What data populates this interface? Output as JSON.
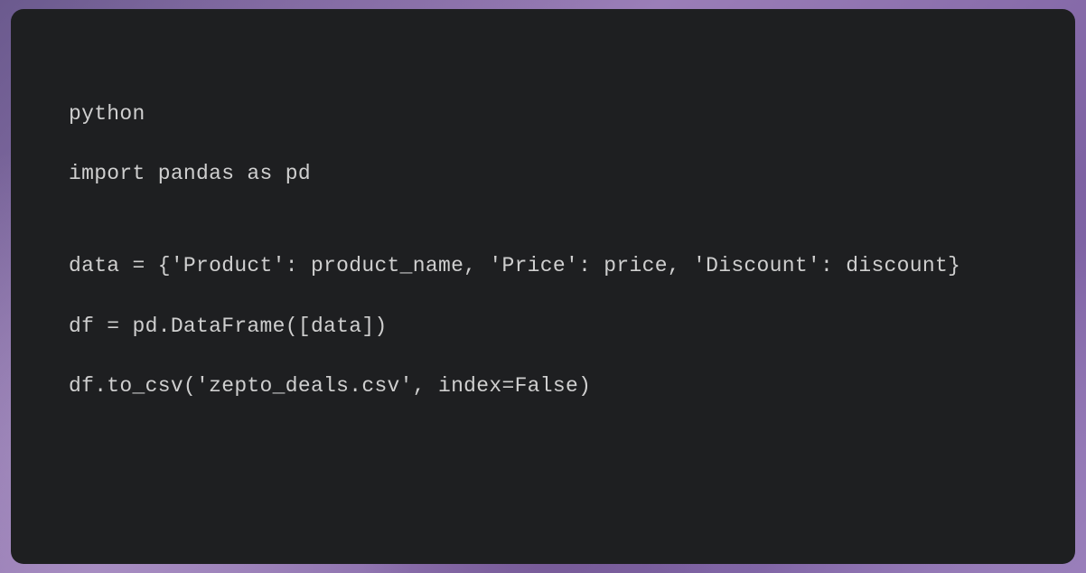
{
  "code": {
    "language_label": "python",
    "lines": [
      "import pandas as pd",
      "data = {'Product': product_name, 'Price': price, 'Discount': discount}",
      "df = pd.DataFrame([data])",
      "df.to_csv('zepto_deals.csv', index=False)"
    ]
  }
}
